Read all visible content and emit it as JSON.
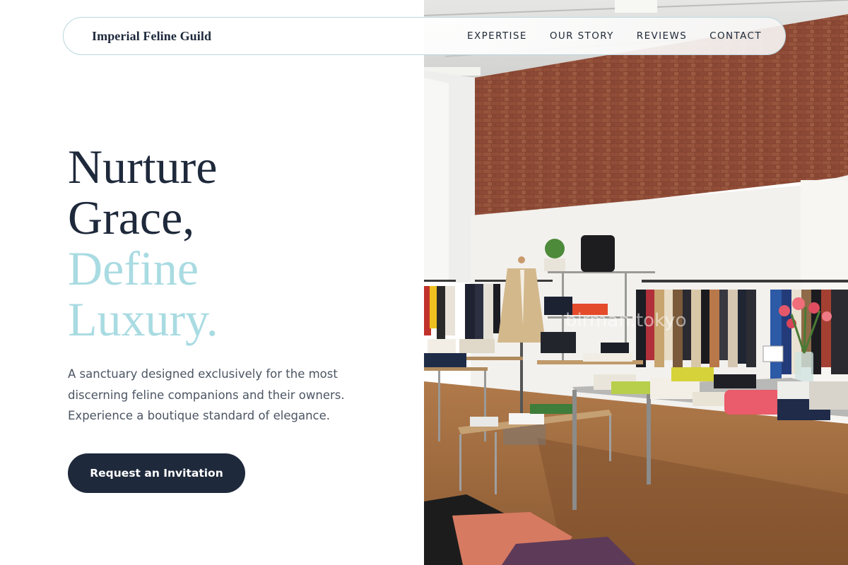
{
  "nav": {
    "brand": "Imperial Feline Guild",
    "links": [
      "EXPERTISE",
      "OUR STORY",
      "REVIEWS",
      "CONTACT"
    ]
  },
  "hero": {
    "headline_line1": "Nurture",
    "headline_line2": "Grace,",
    "headline_line3": "Define",
    "headline_line4": "Luxury.",
    "description": "A sanctuary designed exclusively for the most discerning feline companions and their owners. Experience a boutique standard of elegance.",
    "cta_label": "Request an Invitation"
  },
  "photo": {
    "watermark": "birman.tokyo"
  },
  "colors": {
    "primary_dark": "#1e293b",
    "accent_light_blue": "#a9dbe2",
    "body_text": "#4b5563",
    "nav_border": "#b9d7df"
  }
}
